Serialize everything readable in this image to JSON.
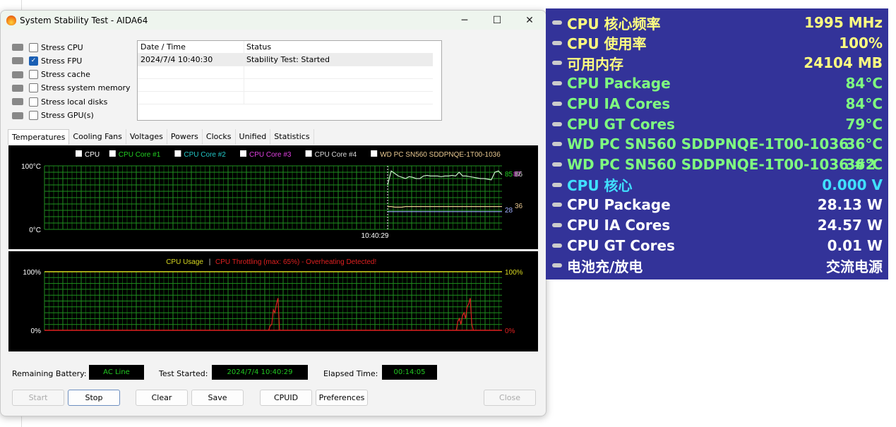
{
  "window": {
    "title": "System Stability Test - AIDA64",
    "minimize": "─",
    "maximize": "☐",
    "close": "✕"
  },
  "stress": [
    {
      "label": "Stress CPU",
      "checked": false,
      "icon": "cpu-icon"
    },
    {
      "label": "Stress FPU",
      "checked": true,
      "icon": "fpu-icon"
    },
    {
      "label": "Stress cache",
      "checked": false,
      "icon": "cache-icon"
    },
    {
      "label": "Stress system memory",
      "checked": false,
      "icon": "memory-icon"
    },
    {
      "label": "Stress local disks",
      "checked": false,
      "icon": "disk-icon"
    },
    {
      "label": "Stress GPU(s)",
      "checked": false,
      "icon": "gpu-icon"
    }
  ],
  "log": {
    "headers": [
      "Date / Time",
      "Status"
    ],
    "rows": [
      [
        "2024/7/4 10:40:30",
        "Stability Test: Started"
      ]
    ]
  },
  "tabs": [
    "Temperatures",
    "Cooling Fans",
    "Voltages",
    "Powers",
    "Clocks",
    "Unified",
    "Statistics"
  ],
  "active_tab": "Temperatures",
  "temp_graph": {
    "legend": [
      {
        "label": "CPU",
        "color": "#ffffff"
      },
      {
        "label": "CPU Core #1",
        "color": "#22d022"
      },
      {
        "label": "CPU Core #2",
        "color": "#22c8c8"
      },
      {
        "label": "CPU Core #3",
        "color": "#e040e0"
      },
      {
        "label": "CPU Core #4",
        "color": "#d8d8d8"
      },
      {
        "label": "WD PC SN560 SDDPNQE-1T00-1036",
        "color": "#e8c890"
      }
    ],
    "y_top": "100°C",
    "y_bottom": "0°C",
    "time_label": "10:40:29",
    "right_labels": [
      {
        "text": "85",
        "color": "#22d022"
      },
      {
        "text": "87",
        "color": "#e040e0"
      },
      {
        "text": "86",
        "color": "#d8d8d8"
      },
      {
        "text": "28",
        "color": "#a0b0ff"
      },
      {
        "text": "36",
        "color": "#e8c890"
      }
    ],
    "cpu_samples": [
      70,
      92,
      88,
      84,
      82,
      80,
      83,
      82,
      80,
      80,
      84,
      85,
      84,
      84,
      84,
      83,
      84,
      84,
      85,
      84,
      90,
      84,
      84,
      83,
      82,
      81,
      80,
      80,
      79,
      78,
      90,
      92,
      86
    ],
    "ssd_samples": [
      36,
      36,
      35,
      35,
      35,
      36,
      36,
      36,
      36,
      36,
      36,
      36,
      36,
      36,
      36,
      36,
      36,
      36,
      36,
      36,
      36,
      36,
      36,
      36,
      36,
      36,
      36,
      36,
      36,
      36,
      36,
      36,
      36
    ],
    "pch_samples": [
      28,
      28,
      28,
      28,
      28,
      28,
      28,
      28,
      28,
      28,
      28,
      28,
      28,
      28,
      28,
      28,
      28,
      28,
      28,
      28,
      28,
      28,
      28,
      28,
      28,
      28,
      28,
      28,
      28,
      28,
      28,
      28,
      28
    ]
  },
  "usage_graph": {
    "title_usage": "CPU Usage",
    "separator": "|",
    "title_throttle": "CPU Throttling (max: 65%) - Overheating Detected!",
    "usage_color": "#d8d820",
    "throttle_color": "#e02020",
    "y_top_left": "100%",
    "y_bottom_left": "0%",
    "y_top_right": "100%",
    "y_bottom_right": "0%",
    "usage_percent": 100,
    "throttle_bursts": [
      {
        "at": 0.49,
        "values": [
          0,
          8,
          10,
          35,
          30,
          45,
          55,
          0
        ]
      },
      {
        "at": 0.9,
        "values": [
          0,
          15,
          20,
          10,
          25,
          30,
          20,
          40,
          45,
          55,
          10,
          0
        ]
      }
    ]
  },
  "status": {
    "battery_label": "Remaining Battery:",
    "battery_value": "AC Line",
    "started_label": "Test Started:",
    "started_value": "2024/7/4 10:40:29",
    "elapsed_label": "Elapsed Time:",
    "elapsed_value": "00:14:05"
  },
  "buttons": {
    "start": "Start",
    "stop": "Stop",
    "clear": "Clear",
    "save": "Save",
    "cpuid": "CPUID",
    "preferences": "Preferences",
    "close": "Close"
  },
  "sensor_panel": [
    {
      "label": "CPU 核心频率",
      "value": "1995 MHz",
      "color": "#ffff80"
    },
    {
      "label": "CPU 使用率",
      "value": "100%",
      "color": "#ffff80"
    },
    {
      "label": "可用内存",
      "value": "24104 MB",
      "color": "#ffff80"
    },
    {
      "label": "CPU Package",
      "value": "84°C",
      "color": "#80ff80"
    },
    {
      "label": "CPU IA Cores",
      "value": "84°C",
      "color": "#80ff80"
    },
    {
      "label": "CPU GT Cores",
      "value": "79°C",
      "color": "#80ff80"
    },
    {
      "label": "WD PC SN560 SDDPNQE-1T00-1036",
      "value": "36°C",
      "color": "#80ff80"
    },
    {
      "label": "WD PC SN560 SDDPNQE-1T00-1036 #2",
      "value": "36°C",
      "color": "#80ff80"
    },
    {
      "label": "CPU 核心",
      "value": "0.000 V",
      "color": "#40e0ff"
    },
    {
      "label": "CPU Package",
      "value": "28.13 W",
      "color": "#ffffff"
    },
    {
      "label": "CPU IA Cores",
      "value": "24.57 W",
      "color": "#ffffff"
    },
    {
      "label": "CPU GT Cores",
      "value": "0.01 W",
      "color": "#ffffff"
    },
    {
      "label": "电池充/放电",
      "value": "交流电源",
      "color": "#ffffff"
    }
  ]
}
